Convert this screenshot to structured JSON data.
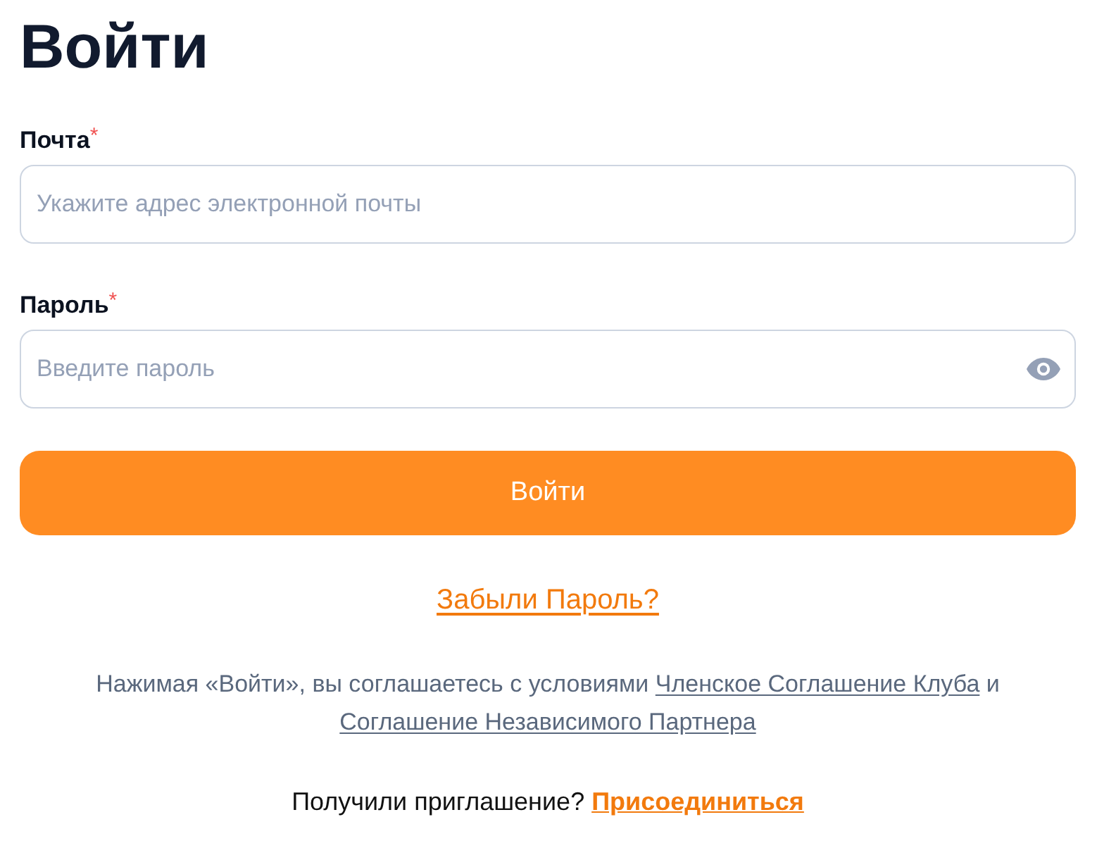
{
  "title": "Войти",
  "form": {
    "fields": [
      {
        "kind": "email",
        "label": "Почта",
        "required_mark": "*",
        "placeholder": "Укажите адрес электронной почты"
      },
      {
        "kind": "password",
        "label": "Пароль",
        "required_mark": "*",
        "placeholder": "Введите пароль"
      }
    ],
    "submit_button": "Войти",
    "forgot_link": "Забыли Пароль?"
  },
  "terms": {
    "text": "Нажимая «Войти», вы соглашаетесь с условиями",
    "links": [
      "Членское Соглашение Клуба",
      "Соглашение Независимого Партнера"
    ],
    "conjunction": "и"
  },
  "invite": {
    "text": "Получили приглашение?",
    "link": "Присоединиться"
  }
}
